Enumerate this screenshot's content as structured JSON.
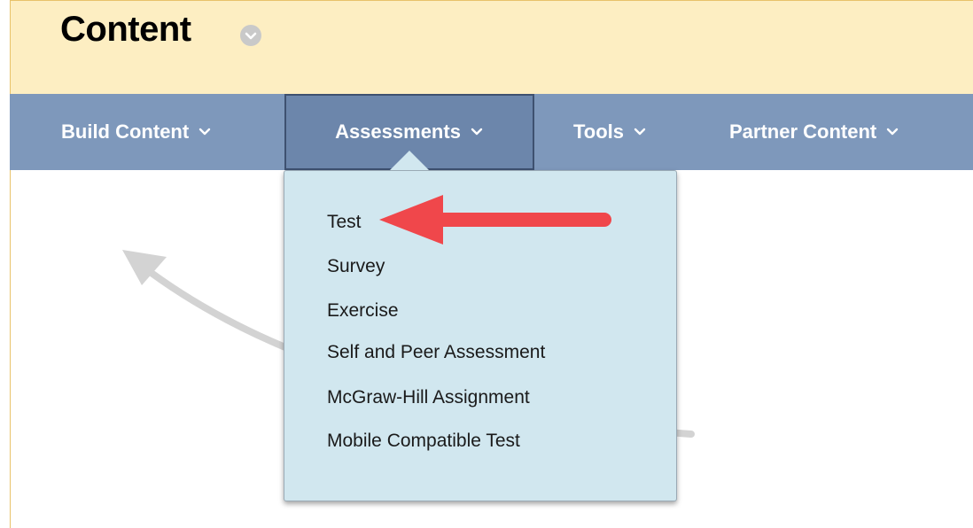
{
  "page": {
    "title": "Content"
  },
  "toolbar": {
    "items": [
      {
        "label": "Build Content"
      },
      {
        "label": "Assessments"
      },
      {
        "label": "Tools"
      },
      {
        "label": "Partner Content"
      }
    ]
  },
  "assessments_menu": {
    "items": [
      {
        "label": "Test"
      },
      {
        "label": "Survey"
      },
      {
        "label": "Exercise"
      },
      {
        "label": "Self and Peer Assessment"
      },
      {
        "label": "McGraw-Hill Assignment"
      },
      {
        "label": "Mobile Compatible Test"
      }
    ]
  },
  "colors": {
    "header_bg": "#fdeec2",
    "toolbar_bg": "#7e98bb",
    "menu_bg": "#d1e7ef",
    "annotation_arrow": "#f0474b"
  },
  "icons": {
    "title_options": "chevron-down-circle-icon",
    "toolbar_caret": "chevron-down-icon",
    "annotation": "red-arrow-icon"
  }
}
